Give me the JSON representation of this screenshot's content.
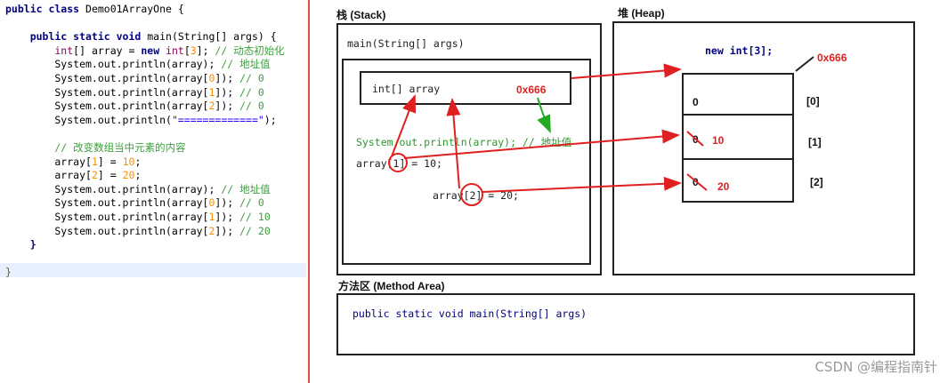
{
  "code": {
    "lines": [
      [
        {
          "t": "public class ",
          "c": "kw"
        },
        {
          "t": "Demo01ArrayOne {",
          "c": ""
        }
      ],
      [],
      [
        {
          "t": "    public static void ",
          "c": "kw"
        },
        {
          "t": "main(String[] args) {",
          "c": ""
        }
      ],
      [
        {
          "t": "        int",
          "c": "kw2"
        },
        {
          "t": "[] array = ",
          "c": ""
        },
        {
          "t": "new",
          "c": "kw"
        },
        {
          "t": " int",
          "c": "kw2"
        },
        {
          "t": "[",
          "c": ""
        },
        {
          "t": "3",
          "c": "num"
        },
        {
          "t": "]; ",
          "c": ""
        },
        {
          "t": "// 动态初始化",
          "c": "cm"
        }
      ],
      [
        {
          "t": "        System.out.println(array); ",
          "c": ""
        },
        {
          "t": "// 地址值",
          "c": "cm"
        }
      ],
      [
        {
          "t": "        System.out.println(array[",
          "c": ""
        },
        {
          "t": "0",
          "c": "num"
        },
        {
          "t": "]); ",
          "c": ""
        },
        {
          "t": "// 0",
          "c": "cm"
        }
      ],
      [
        {
          "t": "        System.out.println(array[",
          "c": ""
        },
        {
          "t": "1",
          "c": "num"
        },
        {
          "t": "]); ",
          "c": ""
        },
        {
          "t": "// 0",
          "c": "cm"
        }
      ],
      [
        {
          "t": "        System.out.println(array[",
          "c": ""
        },
        {
          "t": "2",
          "c": "num"
        },
        {
          "t": "]); ",
          "c": ""
        },
        {
          "t": "// 0",
          "c": "cm"
        }
      ],
      [
        {
          "t": "        System.out.println(",
          "c": ""
        },
        {
          "t": "\"=============\"",
          "c": "str"
        },
        {
          "t": ");",
          "c": ""
        }
      ],
      [],
      [
        {
          "t": "        // 改变数组当中元素的内容",
          "c": "cm"
        }
      ],
      [
        {
          "t": "        array[",
          "c": ""
        },
        {
          "t": "1",
          "c": "num"
        },
        {
          "t": "] = ",
          "c": ""
        },
        {
          "t": "10",
          "c": "num"
        },
        {
          "t": ";",
          "c": ""
        }
      ],
      [
        {
          "t": "        array[",
          "c": ""
        },
        {
          "t": "2",
          "c": "num"
        },
        {
          "t": "] = ",
          "c": ""
        },
        {
          "t": "20",
          "c": "num"
        },
        {
          "t": ";",
          "c": ""
        }
      ],
      [
        {
          "t": "        System.out.println(array); ",
          "c": ""
        },
        {
          "t": "// 地址值",
          "c": "cm"
        }
      ],
      [
        {
          "t": "        System.out.println(array[",
          "c": ""
        },
        {
          "t": "0",
          "c": "num"
        },
        {
          "t": "]); ",
          "c": ""
        },
        {
          "t": "// 0",
          "c": "cm"
        }
      ],
      [
        {
          "t": "        System.out.println(array[",
          "c": ""
        },
        {
          "t": "1",
          "c": "num"
        },
        {
          "t": "]); ",
          "c": ""
        },
        {
          "t": "// 10",
          "c": "cm"
        }
      ],
      [
        {
          "t": "        System.out.println(array[",
          "c": ""
        },
        {
          "t": "2",
          "c": "num"
        },
        {
          "t": "]); ",
          "c": ""
        },
        {
          "t": "// 20",
          "c": "cm"
        }
      ],
      [
        {
          "t": "    }",
          "c": "kw"
        }
      ],
      [],
      [
        {
          "t": "}",
          "c": "brace"
        }
      ]
    ]
  },
  "stack": {
    "title": "栈 (Stack)",
    "frame_label": "main(String[] args)",
    "var_label": "int[] array",
    "addr": "0x666",
    "println_text": "System.out.println(array); // 地址值",
    "assign1": "array[1] = 10;",
    "assign2": "array[2] = 20;"
  },
  "heap": {
    "title": "堆 (Heap)",
    "new_expr": "new int[3];",
    "addr": "0x666",
    "cells": [
      {
        "old": "0",
        "new": "",
        "index": "[0]"
      },
      {
        "old": "0",
        "new": "10",
        "index": "[1]"
      },
      {
        "old": "0",
        "new": "20",
        "index": "[2]"
      }
    ]
  },
  "method_area": {
    "title": "方法区 (Method Area)",
    "content": "public static void main(String[] args)"
  },
  "watermark": "CSDN @编程指南针",
  "colors": {
    "arrow": "#e02020",
    "green_arrow": "#22aa22",
    "divider": "#e04a4a"
  }
}
